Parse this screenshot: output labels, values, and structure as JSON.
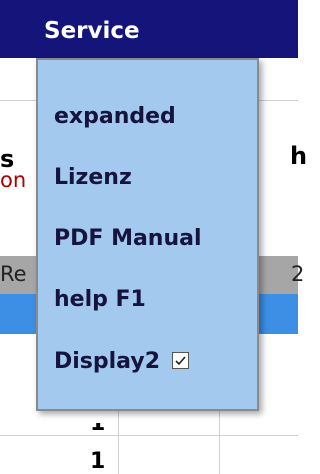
{
  "menubar": {
    "title": "Service"
  },
  "background": {
    "heading_fragment": "s",
    "red_fragment": "on",
    "right_fragment": "h",
    "column_header_left": "Re",
    "column_header_right": "2",
    "row_values": [
      "1",
      "1"
    ]
  },
  "dropdown": {
    "items": [
      {
        "label": "expanded"
      },
      {
        "label": "Lizenz"
      },
      {
        "label": "PDF Manual"
      },
      {
        "label": "help F1"
      },
      {
        "label": "Display2",
        "checked": true
      }
    ]
  }
}
